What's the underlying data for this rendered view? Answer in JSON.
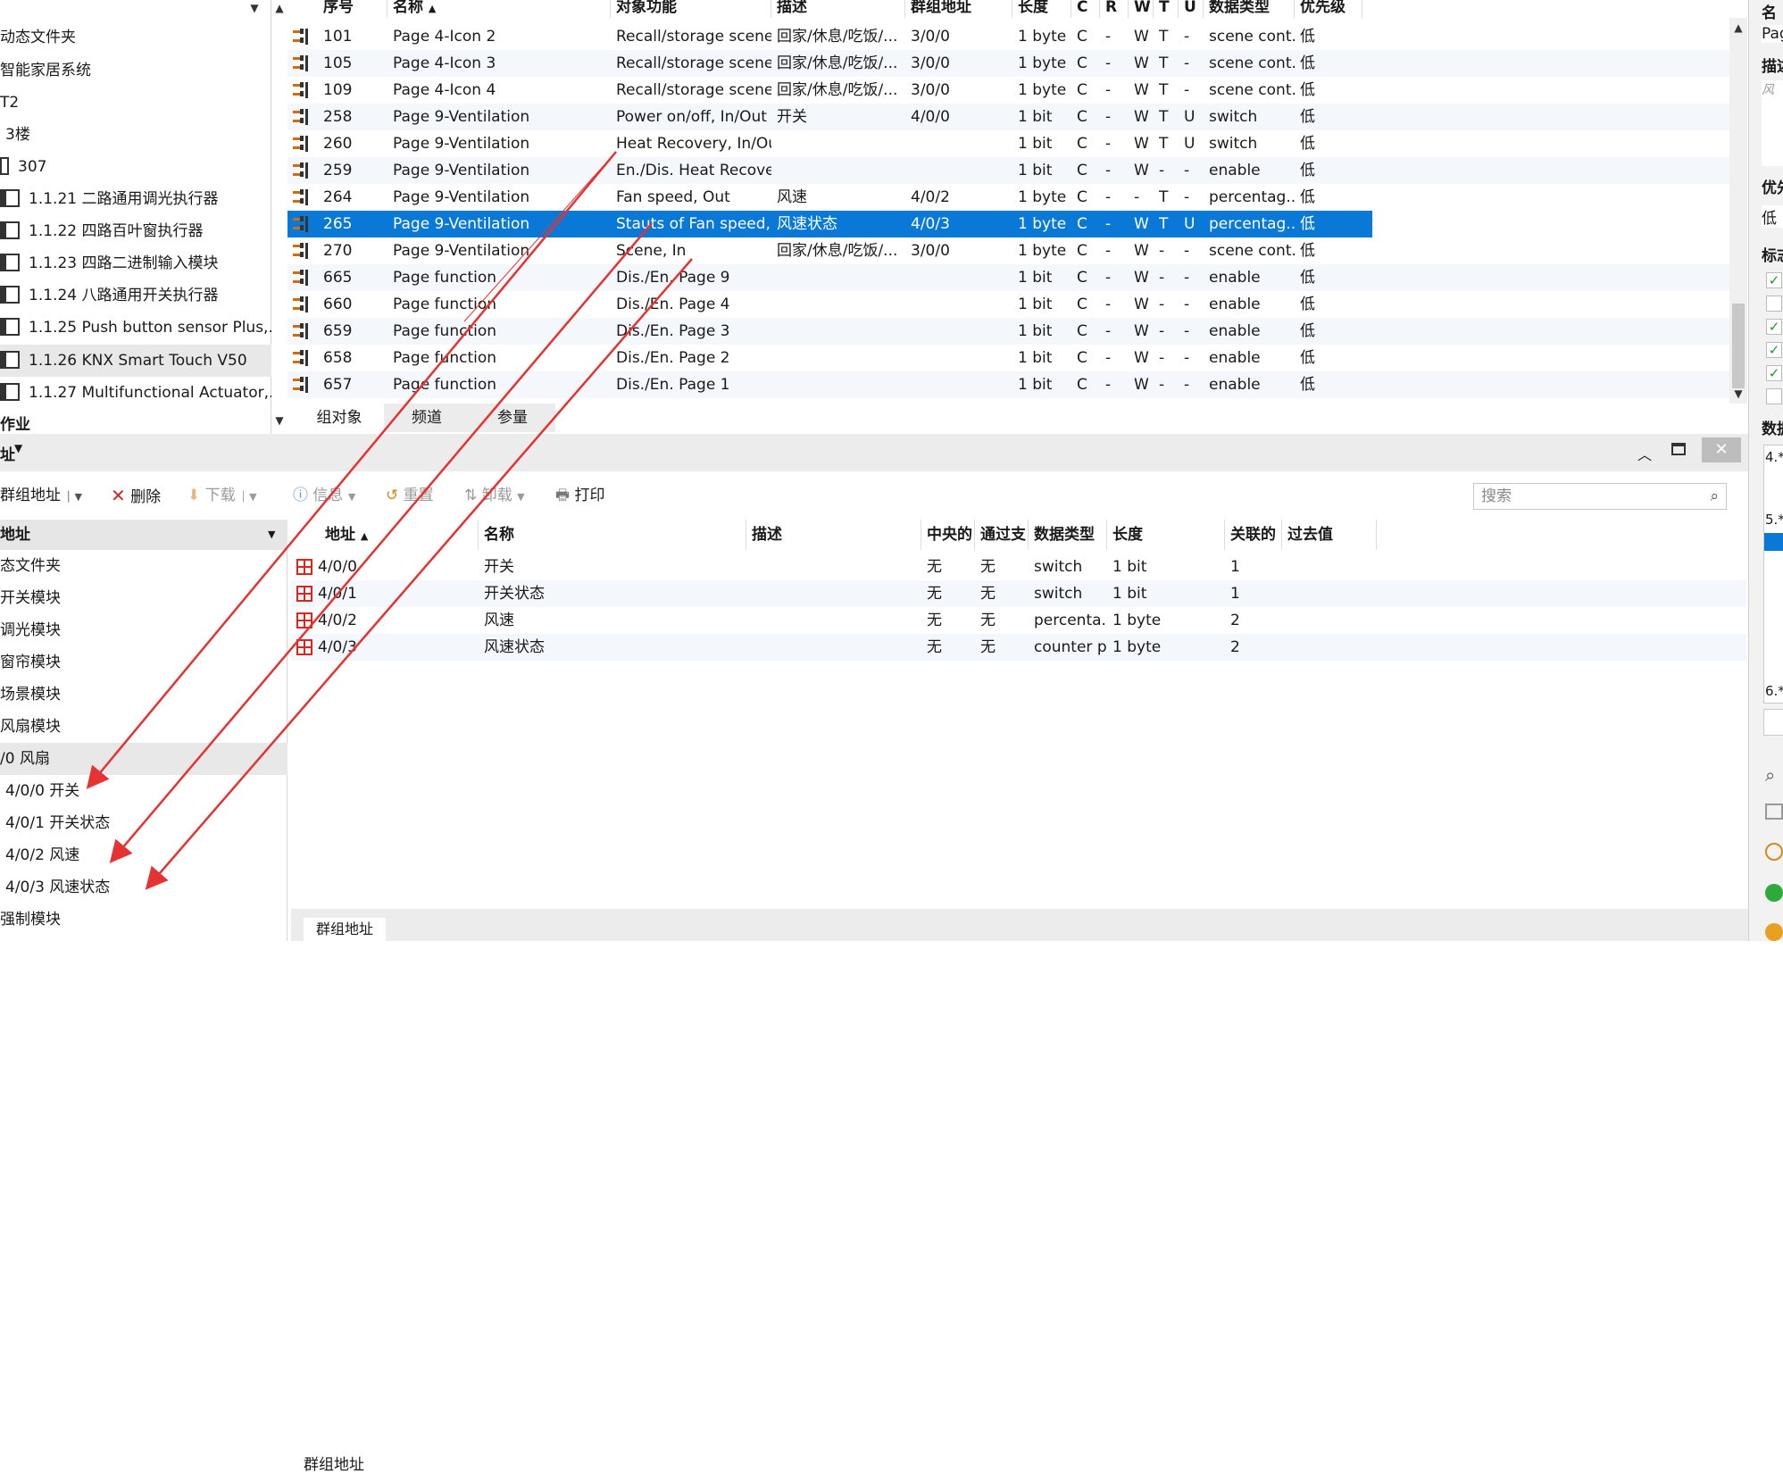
{
  "tree_top": {
    "items": [
      {
        "label": "动态文件夹",
        "level": "folder"
      },
      {
        "label": "智能家居系统",
        "level": "project"
      },
      {
        "label": "T2",
        "level": "building"
      },
      {
        "label": "3楼",
        "level": "floor"
      },
      {
        "label": "307",
        "level": "room"
      },
      {
        "label": "1.1.21 二路通用调光执行器",
        "level": "device"
      },
      {
        "label": "1.1.22 四路百叶窗执行器",
        "level": "device"
      },
      {
        "label": "1.1.23 四路二进制输入模块",
        "level": "device"
      },
      {
        "label": "1.1.24 八路通用开关执行器",
        "level": "device"
      },
      {
        "label": "1.1.25 Push button sensor Plus,...",
        "level": "device"
      },
      {
        "label": "1.1.26 KNX Smart Touch V50",
        "level": "device",
        "selected": true
      },
      {
        "label": "1.1.27 Multifunctional Actuator,...",
        "level": "device"
      },
      {
        "label": "作业",
        "level": "section"
      }
    ]
  },
  "grid_top": {
    "columns": [
      "序号",
      "名称",
      "对象功能",
      "描述",
      "群组地址",
      "长度",
      "C",
      "R",
      "W",
      "T",
      "U",
      "数据类型",
      "优先级"
    ],
    "rows": [
      {
        "num": "101",
        "name": "Page 4-Icon 2",
        "func": "Recall/storage scene...",
        "desc": "回家/休息/吃饭/...",
        "ga": "3/0/0",
        "len": "1 byte",
        "c": "C",
        "r": "-",
        "w": "W",
        "t": "T",
        "u": "-",
        "dtype": "scene cont...",
        "prio": "低"
      },
      {
        "num": "105",
        "name": "Page 4-Icon 3",
        "func": "Recall/storage scene...",
        "desc": "回家/休息/吃饭/...",
        "ga": "3/0/0",
        "len": "1 byte",
        "c": "C",
        "r": "-",
        "w": "W",
        "t": "T",
        "u": "-",
        "dtype": "scene cont...",
        "prio": "低"
      },
      {
        "num": "109",
        "name": "Page 4-Icon 4",
        "func": "Recall/storage scene...",
        "desc": "回家/休息/吃饭/...",
        "ga": "3/0/0",
        "len": "1 byte",
        "c": "C",
        "r": "-",
        "w": "W",
        "t": "T",
        "u": "-",
        "dtype": "scene cont...",
        "prio": "低"
      },
      {
        "num": "258",
        "name": "Page 9-Ventilation",
        "func": "Power on/off, In/Out",
        "desc": "开关",
        "ga": "4/0/0",
        "len": "1 bit",
        "c": "C",
        "r": "-",
        "w": "W",
        "t": "T",
        "u": "U",
        "dtype": "switch",
        "prio": "低"
      },
      {
        "num": "260",
        "name": "Page 9-Ventilation",
        "func": "Heat Recovery, In/Out",
        "desc": "",
        "ga": "",
        "len": "1 bit",
        "c": "C",
        "r": "-",
        "w": "W",
        "t": "T",
        "u": "U",
        "dtype": "switch",
        "prio": "低"
      },
      {
        "num": "259",
        "name": "Page 9-Ventilation",
        "func": "En./Dis. Heat Recover...",
        "desc": "",
        "ga": "",
        "len": "1 bit",
        "c": "C",
        "r": "-",
        "w": "W",
        "t": "-",
        "u": "-",
        "dtype": "enable",
        "prio": "低"
      },
      {
        "num": "264",
        "name": "Page 9-Ventilation",
        "func": "Fan speed, Out",
        "desc": "风速",
        "ga": "4/0/2",
        "len": "1 byte",
        "c": "C",
        "r": "-",
        "w": "-",
        "t": "T",
        "u": "-",
        "dtype": "percentag...",
        "prio": "低"
      },
      {
        "num": "265",
        "name": "Page 9-Ventilation",
        "func": "Stauts of Fan speed, In",
        "desc": "风速状态",
        "ga": "4/0/3",
        "len": "1 byte",
        "c": "C",
        "r": "-",
        "w": "W",
        "t": "T",
        "u": "U",
        "dtype": "percentag...",
        "prio": "低",
        "selected": true
      },
      {
        "num": "270",
        "name": "Page 9-Ventilation",
        "func": "Scene, In",
        "desc": "回家/休息/吃饭/...",
        "ga": "3/0/0",
        "len": "1 byte",
        "c": "C",
        "r": "-",
        "w": "W",
        "t": "-",
        "u": "-",
        "dtype": "scene cont...",
        "prio": "低"
      },
      {
        "num": "665",
        "name": "Page function",
        "func": "Dis./En. Page 9",
        "desc": "",
        "ga": "",
        "len": "1 bit",
        "c": "C",
        "r": "-",
        "w": "W",
        "t": "-",
        "u": "-",
        "dtype": "enable",
        "prio": "低"
      },
      {
        "num": "660",
        "name": "Page function",
        "func": "Dis./En. Page 4",
        "desc": "",
        "ga": "",
        "len": "1 bit",
        "c": "C",
        "r": "-",
        "w": "W",
        "t": "-",
        "u": "-",
        "dtype": "enable",
        "prio": "低"
      },
      {
        "num": "659",
        "name": "Page function",
        "func": "Dis./En. Page 3",
        "desc": "",
        "ga": "",
        "len": "1 bit",
        "c": "C",
        "r": "-",
        "w": "W",
        "t": "-",
        "u": "-",
        "dtype": "enable",
        "prio": "低"
      },
      {
        "num": "658",
        "name": "Page function",
        "func": "Dis./En. Page 2",
        "desc": "",
        "ga": "",
        "len": "1 bit",
        "c": "C",
        "r": "-",
        "w": "W",
        "t": "-",
        "u": "-",
        "dtype": "enable",
        "prio": "低"
      },
      {
        "num": "657",
        "name": "Page function",
        "func": "Dis./En. Page 1",
        "desc": "",
        "ga": "",
        "len": "1 bit",
        "c": "C",
        "r": "-",
        "w": "W",
        "t": "-",
        "u": "-",
        "dtype": "enable",
        "prio": "低"
      }
    ]
  },
  "tabs": [
    "组对象",
    "频道",
    "参量"
  ],
  "panel": {
    "title": "址",
    "toolbar": {
      "group_address": "群组地址",
      "delete": "删除",
      "download": "下载",
      "info": "信息",
      "reset": "重置",
      "unload": "卸载",
      "print": "打印"
    },
    "search_placeholder": "搜索"
  },
  "tree_bot": {
    "header": "地址",
    "items": [
      {
        "label": "态文件夹"
      },
      {
        "label": "开关模块"
      },
      {
        "label": "调光模块"
      },
      {
        "label": "窗帘模块"
      },
      {
        "label": "场景模块"
      },
      {
        "label": "风扇模块"
      },
      {
        "label": "/0 风扇",
        "selected": true
      },
      {
        "label": "4/0/0 开关"
      },
      {
        "label": "4/0/1 开关状态"
      },
      {
        "label": "4/0/2 风速"
      },
      {
        "label": "4/0/3 风速状态"
      },
      {
        "label": "强制模块"
      }
    ]
  },
  "grid_bot": {
    "columns": [
      "地址",
      "名称",
      "描述",
      "中央的",
      "通过支",
      "数据类型",
      "长度",
      "关联的",
      "过去值"
    ],
    "rows": [
      {
        "addr": "4/0/0",
        "name": "开关",
        "desc": "",
        "central": "无",
        "pass": "无",
        "dtype": "switch",
        "len": "1 bit",
        "assoc": "1",
        "past": ""
      },
      {
        "addr": "4/0/1",
        "name": "开关状态",
        "desc": "",
        "central": "无",
        "pass": "无",
        "dtype": "switch",
        "len": "1 bit",
        "assoc": "1",
        "past": ""
      },
      {
        "addr": "4/0/2",
        "name": "风速",
        "desc": "",
        "central": "无",
        "pass": "无",
        "dtype": "percenta...",
        "len": "1 byte",
        "assoc": "2",
        "past": ""
      },
      {
        "addr": "4/0/3",
        "name": "风速状态",
        "desc": "",
        "central": "无",
        "pass": "无",
        "dtype": "counter p...",
        "len": "1 byte",
        "assoc": "2",
        "past": ""
      }
    ],
    "footer_tab": "群组地址"
  },
  "right": {
    "labels": [
      "名",
      "Pag",
      "描述",
      "风",
      "优先",
      "低",
      "标志",
      "数据",
      "4.*",
      "5.*",
      "6.*"
    ]
  },
  "colors": {
    "selection": "#0a78d7",
    "arrow": "#e53232",
    "alt_row": "#f4f7fc"
  }
}
